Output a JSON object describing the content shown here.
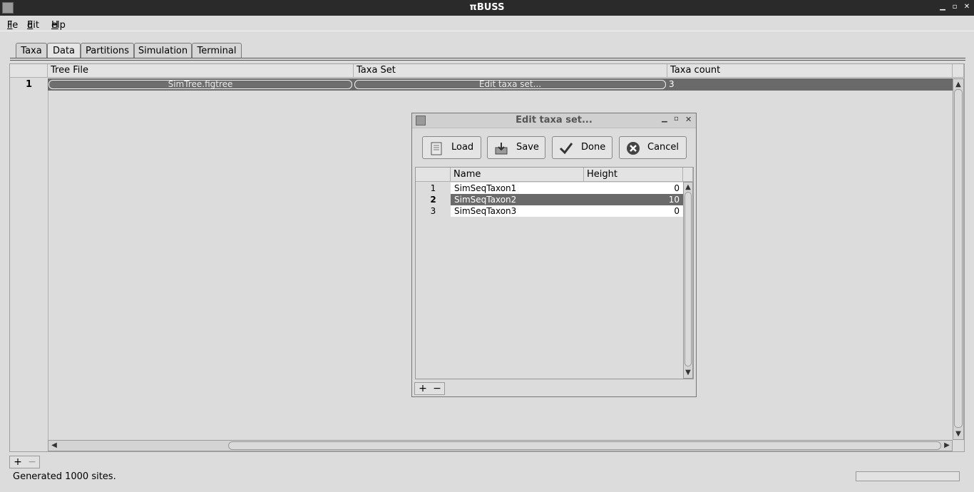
{
  "window": {
    "title": "πBUSS"
  },
  "menu": [
    {
      "label": "File",
      "mnemonic": "F",
      "rest": "ile"
    },
    {
      "label": "Edit",
      "mnemonic": "E",
      "rest": "dit"
    },
    {
      "label": "Help",
      "mnemonic": "H",
      "rest": "elp"
    }
  ],
  "tabs": [
    "Taxa",
    "Data",
    "Partitions",
    "Simulation",
    "Terminal"
  ],
  "selected_tab": "Data",
  "main_table": {
    "columns": [
      "Tree File",
      "Taxa Set",
      "Taxa count"
    ],
    "rows": [
      {
        "num": "1",
        "tree_file": "SimTree.figtree",
        "taxa_set": "Edit taxa set...",
        "taxa_count": "3"
      }
    ]
  },
  "bottom_buttons": {
    "add": "+",
    "remove": "−"
  },
  "status": {
    "text": "Generated 1000 sites."
  },
  "dialog": {
    "title": "Edit taxa set...",
    "buttons": {
      "load": "Load",
      "save": "Save",
      "done": "Done",
      "cancel": "Cancel"
    },
    "columns": [
      "Name",
      "Height"
    ],
    "rows": [
      {
        "num": "1",
        "name": "SimSeqTaxon1",
        "height": "0"
      },
      {
        "num": "2",
        "name": "SimSeqTaxon2",
        "height": "10"
      },
      {
        "num": "3",
        "name": "SimSeqTaxon3",
        "height": "0"
      }
    ],
    "selected_row": "2",
    "add": "+",
    "remove": "−"
  },
  "icons": [
    "app-icon",
    "minimize-icon",
    "maximize-icon",
    "close-icon",
    "load-icon",
    "save-icon",
    "done-check-icon",
    "cancel-x-icon"
  ]
}
